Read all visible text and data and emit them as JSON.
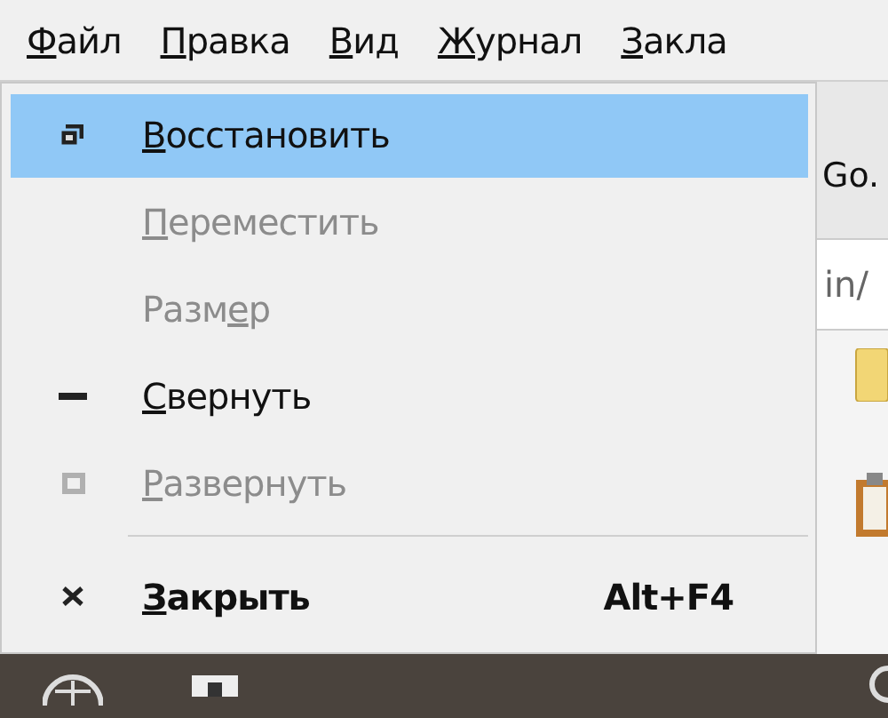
{
  "menu_bar": [
    {
      "key": "Ф",
      "after": "айл"
    },
    {
      "key": "П",
      "after": "равка"
    },
    {
      "key": "В",
      "after": "ид"
    },
    {
      "key": "Ж",
      "after": "урнал"
    },
    {
      "key": "З",
      "after": "акла"
    }
  ],
  "background": {
    "button_text": "Go.",
    "address_text": "in/"
  },
  "system_menu": [
    {
      "kind": "item",
      "key": "В",
      "after": "осстановить",
      "selected": true,
      "disabled": false,
      "default": false
    },
    {
      "kind": "item",
      "key": "П",
      "after": "ереместить",
      "selected": false,
      "disabled": true,
      "default": false
    },
    {
      "kind": "item",
      "before": "Разм",
      "key": "е",
      "after": "р",
      "selected": false,
      "disabled": true,
      "default": false
    },
    {
      "kind": "item",
      "key": "С",
      "after": "вернуть",
      "selected": false,
      "disabled": false,
      "default": false
    },
    {
      "kind": "item",
      "key": "Р",
      "after": "азвернуть",
      "selected": false,
      "disabled": true,
      "default": false
    },
    {
      "kind": "separator"
    },
    {
      "kind": "item",
      "key": "З",
      "after": "акрыть",
      "shortcut": "Alt+F4",
      "selected": false,
      "disabled": false,
      "default": true
    }
  ]
}
